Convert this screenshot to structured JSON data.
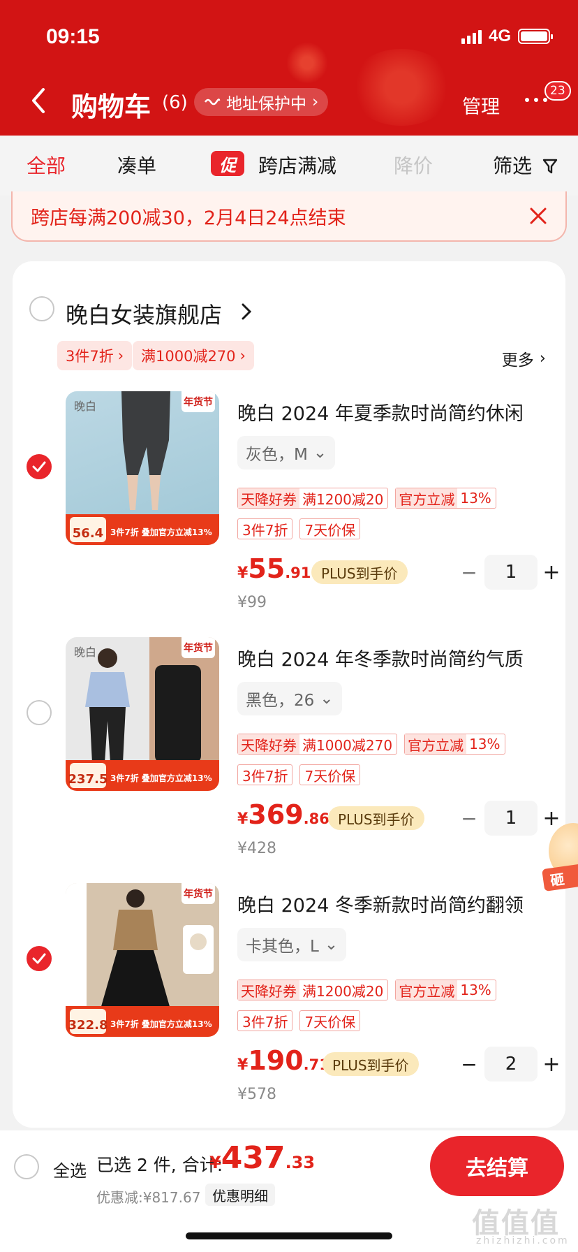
{
  "status_bar": {
    "time": "09:15",
    "network": "4G"
  },
  "header": {
    "title": "购物车",
    "count": "(6)",
    "address_protect": "地址保护中",
    "manage_label": "管理",
    "message_badge": "23"
  },
  "tabs": {
    "all": "全部",
    "bundle": "凑单",
    "cross_store": "跨店满减",
    "promo_mark": "促",
    "price_drop": "降价",
    "filter": "筛选"
  },
  "banner": {
    "text": "跨店每满200减30，2月4日24点结束"
  },
  "store": {
    "name": "晚白女装旗舰店",
    "tags": [
      "3件7折",
      "满1000减270"
    ],
    "more_label": "更多"
  },
  "items": [
    {
      "title": "晚白 2024 年夏季款时尚简约休闲",
      "sku": "灰色，M",
      "checked": true,
      "tag_row1": [
        {
          "lead": "天降好券",
          "text": "满1200减20"
        },
        {
          "lead": "官方立减",
          "text": "13%"
        }
      ],
      "tag_row2": [
        "3件7折",
        "7天价保"
      ],
      "price_currency": "¥",
      "price_int": "55",
      "price_dec": ".91",
      "plus_label": "PLUS到手价",
      "orig_price": "¥99",
      "quantity": "1",
      "img_price": "56.4",
      "img_ribbon": "3件7折 叠加官方立减13%",
      "img_badge": "年货节",
      "img_logo": "晚白"
    },
    {
      "title": "晚白 2024 年冬季款时尚简约气质",
      "sku": "黑色，26",
      "checked": false,
      "tag_row1": [
        {
          "lead": "天降好券",
          "text": "满1000减270"
        },
        {
          "lead": "官方立减",
          "text": "13%"
        }
      ],
      "tag_row2": [
        "3件7折",
        "7天价保"
      ],
      "price_currency": "¥",
      "price_int": "369",
      "price_dec": ".86",
      "plus_label": "PLUS到手价",
      "orig_price": "¥428",
      "quantity": "1",
      "img_price": "237.5",
      "img_ribbon": "3件7折 叠加官方立减13%",
      "img_badge": "年货节",
      "img_logo": "晚白"
    },
    {
      "title": "晚白 2024 冬季新款时尚简约翻领",
      "sku": "卡其色，L",
      "checked": true,
      "tag_row1": [
        {
          "lead": "天降好券",
          "text": "满1200减20"
        },
        {
          "lead": "官方立减",
          "text": "13%"
        }
      ],
      "tag_row2": [
        "3件7折",
        "7天价保"
      ],
      "price_currency": "¥",
      "price_int": "190",
      "price_dec": ".71",
      "plus_label": "PLUS到手价",
      "orig_price": "¥578",
      "quantity": "2",
      "img_price": "322.8",
      "img_ribbon": "3件7折 叠加官方立减13%",
      "img_badge": "年货节",
      "img_logo": ""
    }
  ],
  "bottom": {
    "select_all": "全选",
    "selected_text": "已选 2 件, 合计:",
    "total_currency": "¥",
    "total_int": "437",
    "total_dec": ".33",
    "discount": "优惠减:¥817.67",
    "detail": "优惠明细",
    "checkout": "去结算"
  },
  "float_promo": {
    "text": "砸"
  },
  "watermark": {
    "text": "值值值",
    "sub": "zhizhizhi.com"
  },
  "colors": {
    "brand_red": "#d21414",
    "accent_red": "#e9252b",
    "plus_gold": "#fbe9bb"
  },
  "icons": {
    "back": "chevron-left-icon",
    "close": "close-icon",
    "filter": "filter-icon",
    "check": "check-icon"
  }
}
